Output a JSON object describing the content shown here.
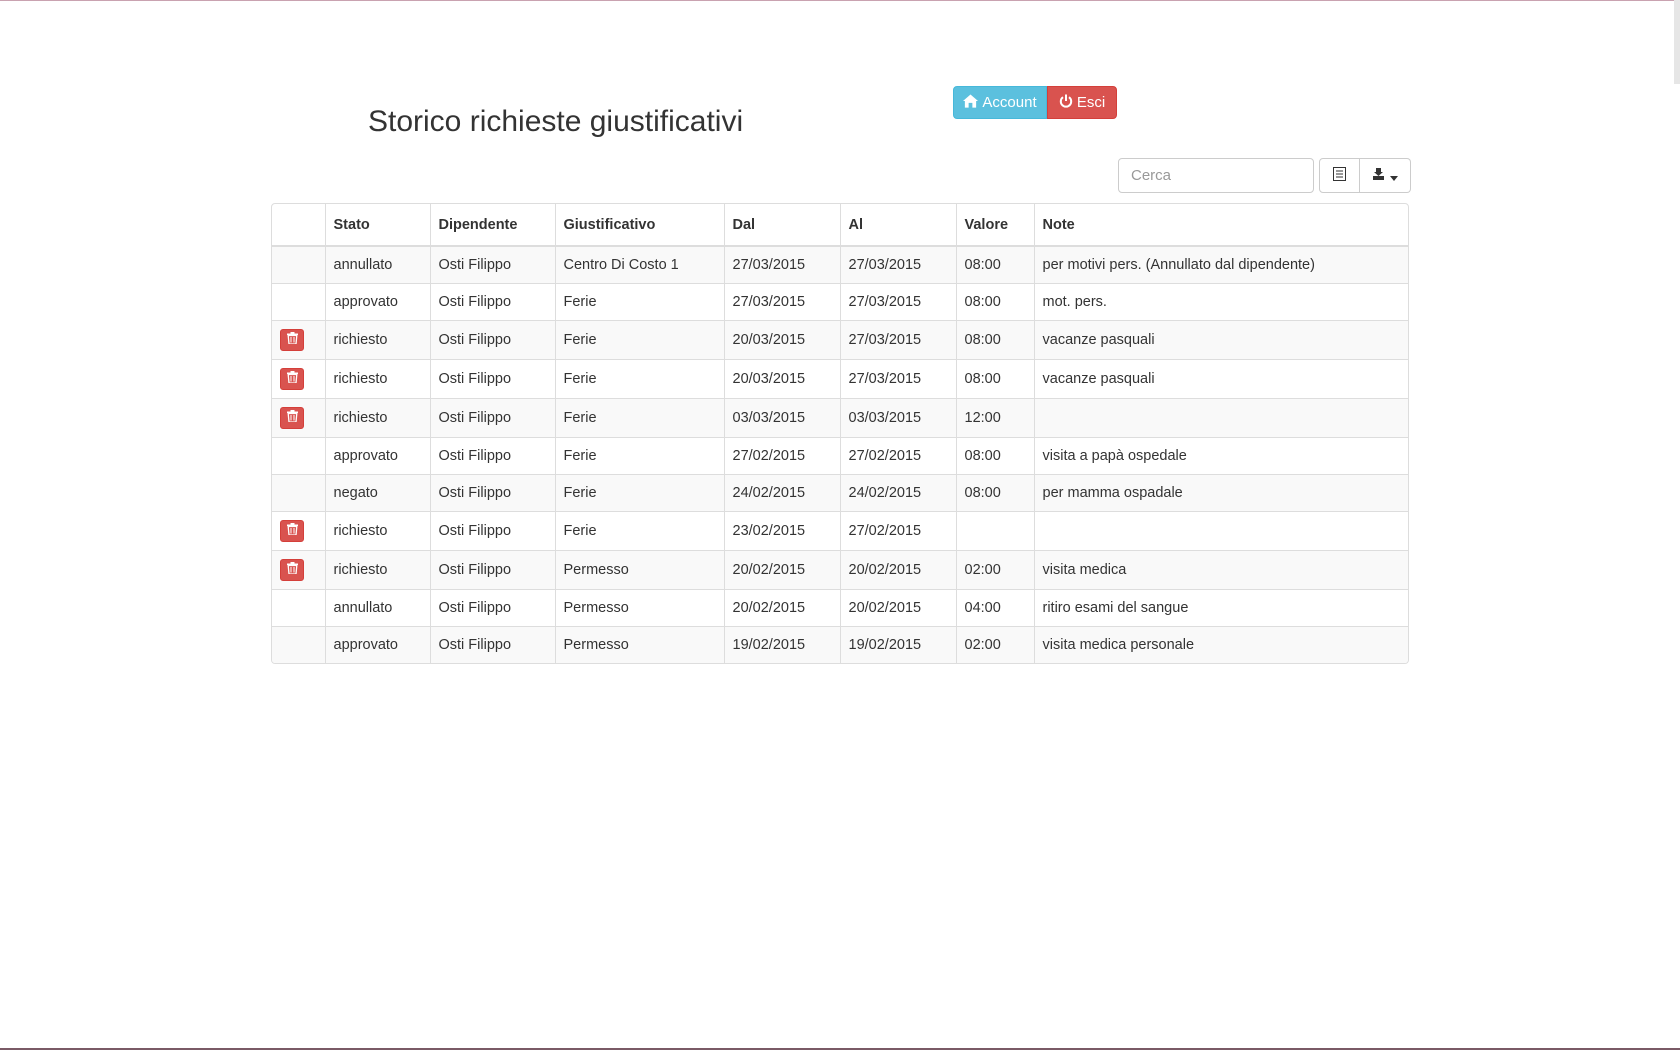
{
  "page": {
    "title": "Storico richieste giustificativi"
  },
  "header": {
    "account_label": "Account",
    "exit_label": "Esci"
  },
  "toolbar": {
    "search_placeholder": "Cerca",
    "search_value": ""
  },
  "table": {
    "headers": [
      "",
      "Stato",
      "Dipendente",
      "Giustificativo",
      "Dal",
      "Al",
      "Valore",
      "Note"
    ],
    "rows": [
      {
        "delete": false,
        "stato": "annullato",
        "dipendente": "Osti Filippo",
        "giustificativo": "Centro Di Costo 1",
        "dal": "27/03/2015",
        "al": "27/03/2015",
        "valore": "08:00",
        "note": "per motivi pers. (Annullato dal dipendente)"
      },
      {
        "delete": false,
        "stato": "approvato",
        "dipendente": "Osti Filippo",
        "giustificativo": "Ferie",
        "dal": "27/03/2015",
        "al": "27/03/2015",
        "valore": "08:00",
        "note": "mot. pers."
      },
      {
        "delete": true,
        "stato": "richiesto",
        "dipendente": "Osti Filippo",
        "giustificativo": "Ferie",
        "dal": "20/03/2015",
        "al": "27/03/2015",
        "valore": "08:00",
        "note": "vacanze pasquali"
      },
      {
        "delete": true,
        "stato": "richiesto",
        "dipendente": "Osti Filippo",
        "giustificativo": "Ferie",
        "dal": "20/03/2015",
        "al": "27/03/2015",
        "valore": "08:00",
        "note": "vacanze pasquali"
      },
      {
        "delete": true,
        "stato": "richiesto",
        "dipendente": "Osti Filippo",
        "giustificativo": "Ferie",
        "dal": "03/03/2015",
        "al": "03/03/2015",
        "valore": "12:00",
        "note": ""
      },
      {
        "delete": false,
        "stato": "approvato",
        "dipendente": "Osti Filippo",
        "giustificativo": "Ferie",
        "dal": "27/02/2015",
        "al": "27/02/2015",
        "valore": "08:00",
        "note": "visita a papà ospedale"
      },
      {
        "delete": false,
        "stato": "negato",
        "dipendente": "Osti Filippo",
        "giustificativo": "Ferie",
        "dal": "24/02/2015",
        "al": "24/02/2015",
        "valore": "08:00",
        "note": "per mamma ospadale"
      },
      {
        "delete": true,
        "stato": "richiesto",
        "dipendente": "Osti Filippo",
        "giustificativo": "Ferie",
        "dal": "23/02/2015",
        "al": "27/02/2015",
        "valore": "",
        "note": ""
      },
      {
        "delete": true,
        "stato": "richiesto",
        "dipendente": "Osti Filippo",
        "giustificativo": "Permesso",
        "dal": "20/02/2015",
        "al": "20/02/2015",
        "valore": "02:00",
        "note": "visita medica"
      },
      {
        "delete": false,
        "stato": "annullato",
        "dipendente": "Osti Filippo",
        "giustificativo": "Permesso",
        "dal": "20/02/2015",
        "al": "20/02/2015",
        "valore": "04:00",
        "note": "ritiro esami del sangue"
      },
      {
        "delete": false,
        "stato": "approvato",
        "dipendente": "Osti Filippo",
        "giustificativo": "Permesso",
        "dal": "19/02/2015",
        "al": "19/02/2015",
        "valore": "02:00",
        "note": "visita medica personale"
      }
    ]
  },
  "icons": {
    "account": "home-icon",
    "exit": "power-icon",
    "delete": "trash-icon",
    "columns": "list-icon",
    "export": "export-icon",
    "caret": "caret-down-icon"
  },
  "colors": {
    "info": "#5bc0de",
    "danger": "#d9534f",
    "border": "#dddddd",
    "stripe": "#f9f9f9"
  }
}
